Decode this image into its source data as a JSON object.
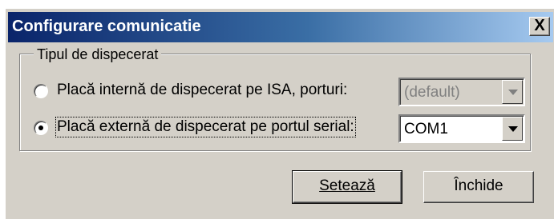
{
  "window": {
    "title": "Configurare comunicatie",
    "close_label": "X"
  },
  "group": {
    "legend": "Tipul de dispecerat",
    "options": [
      {
        "label": "Placă internă de dispecerat pe ISA, porturi:",
        "checked": false,
        "combo_value": "(default)",
        "combo_enabled": false
      },
      {
        "label": "Placă externă de dispecerat pe portul serial:",
        "checked": true,
        "combo_value": "COM1",
        "combo_enabled": true
      }
    ]
  },
  "buttons": {
    "set_label": "Setează",
    "close_label": "Închide"
  }
}
